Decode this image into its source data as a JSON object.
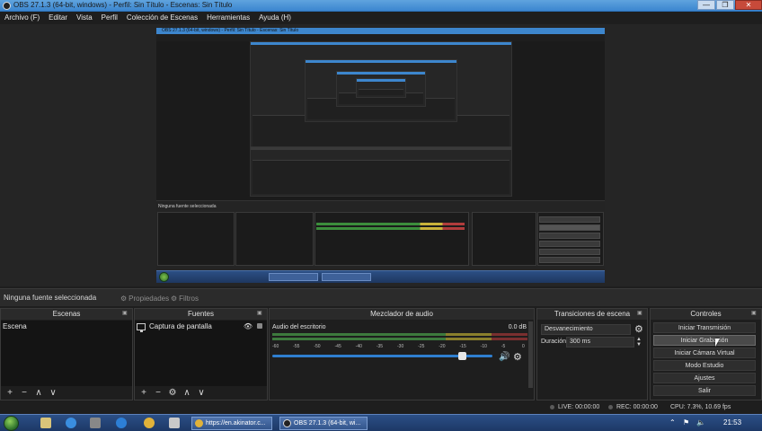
{
  "window": {
    "title": "OBS 27.1.3 (64-bit, windows) - Perfil: Sin Título - Escenas: Sin Título",
    "min": "—",
    "max": "❐",
    "close": "✕"
  },
  "menu": [
    "Archivo (F)",
    "Editar",
    "Vista",
    "Perfil",
    "Colección de Escenas",
    "Herramientas",
    "Ayuda (H)"
  ],
  "context_bar": {
    "no_source": "Ninguna fuente seleccionada",
    "properties": "Propiedades",
    "filters": "Filtros"
  },
  "scenes": {
    "title": "Escenas",
    "items": [
      "Escena"
    ],
    "toolbar": [
      "+",
      "−",
      "∧",
      "∨"
    ]
  },
  "sources": {
    "title": "Fuentes",
    "items": [
      "Captura de pantalla"
    ],
    "toolbar": [
      "+",
      "−",
      "⚙",
      "∧",
      "∨"
    ]
  },
  "mixer": {
    "title": "Mezclador de audio",
    "channel": "Audio del escritorio",
    "db": "0.0 dB",
    "ticks": [
      "-60",
      "-55",
      "-50",
      "-45",
      "-40",
      "-35",
      "-30",
      "-25",
      "-20",
      "-15",
      "-10",
      "-5",
      "0"
    ],
    "volume": 0.86
  },
  "transitions": {
    "title": "Transiciones de escena",
    "selected": "Desvanecimiento",
    "duration_label": "Duración",
    "duration_value": "300 ms"
  },
  "controls": {
    "title": "Controles",
    "buttons": [
      "Iniciar Transmisión",
      "Iniciar Grabación",
      "Iniciar Cámara Virtual",
      "Modo Estudio",
      "Ajustes",
      "Salir"
    ]
  },
  "status": {
    "live": "LIVE: 00:00:00",
    "rec": "REC: 00:00:00",
    "cpu": "CPU: 7.3%, 10.69 fps"
  },
  "taskbar": {
    "task1": "https://en.akinator.c...",
    "task2": "OBS 27.1.3 (64-bit, wi...",
    "clock": "21:53"
  },
  "colors": {
    "titlebar": "#3c86cf",
    "taskbar": "#1d3866",
    "meter_green": "#3d7a3d",
    "slider_blue": "#2f7fd0"
  }
}
